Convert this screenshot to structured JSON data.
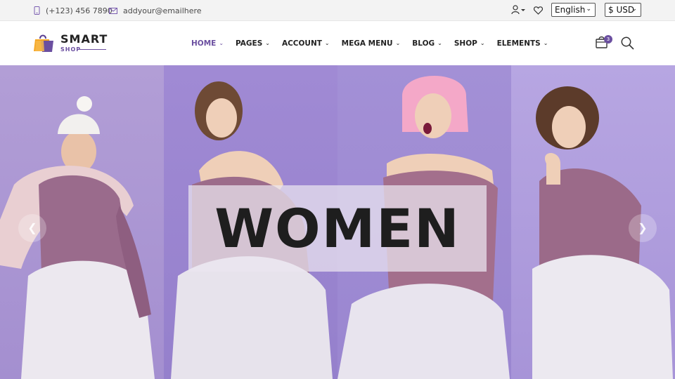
{
  "topbar": {
    "phone": "(+123) 456 7890",
    "email": "addyour@emailhere",
    "language": "English",
    "currency": "$ USD"
  },
  "logo": {
    "name": "SMART",
    "tagline": "SHOP"
  },
  "nav": [
    {
      "label": "HOME",
      "active": true
    },
    {
      "label": "PAGES"
    },
    {
      "label": "ACCOUNT"
    },
    {
      "label": "MEGA MENU"
    },
    {
      "label": "BLOG"
    },
    {
      "label": "SHOP"
    },
    {
      "label": "ELEMENTS"
    }
  ],
  "cart": {
    "count": "3"
  },
  "hero": {
    "title": "WOMEN"
  },
  "colors": {
    "accent": "#6b4fa0",
    "hero_bg": "#a792d4"
  },
  "icons": [
    "phone-icon",
    "mail-icon",
    "user-icon",
    "heart-icon",
    "cart-icon",
    "search-icon",
    "chevron-left-icon",
    "chevron-right-icon"
  ]
}
